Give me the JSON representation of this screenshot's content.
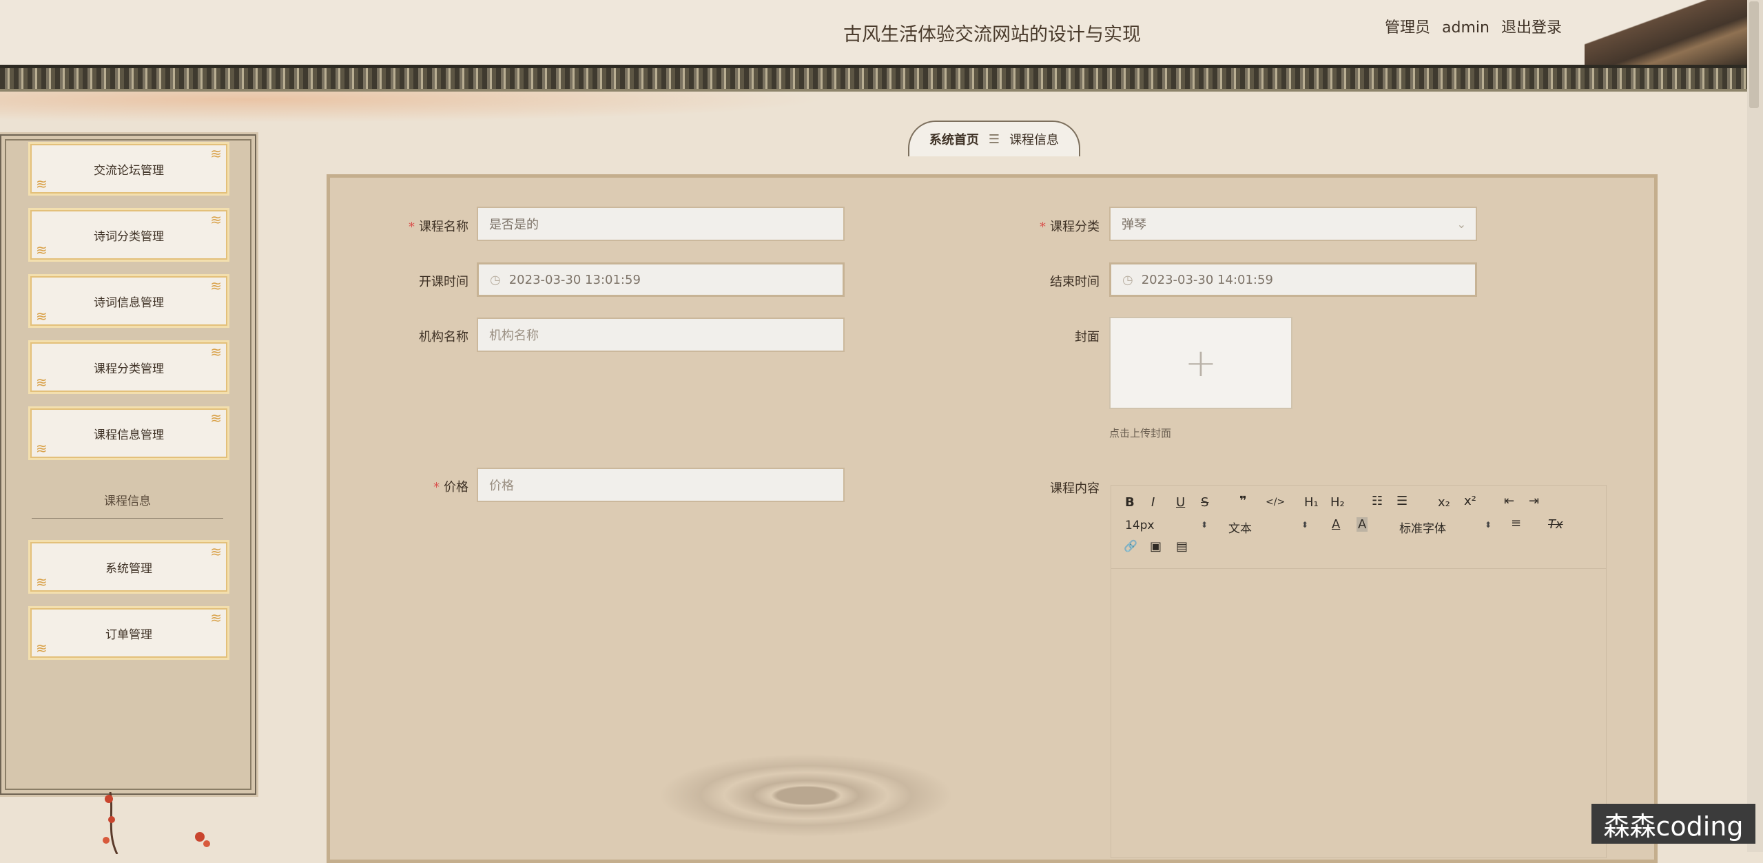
{
  "header": {
    "title": "古风生活体验交流网站的设计与实现",
    "user_role": "管理员",
    "username": "admin",
    "logout": "退出登录"
  },
  "sidebar": {
    "items_top": [
      {
        "label": "交流论坛管理"
      },
      {
        "label": "诗词分类管理"
      },
      {
        "label": "诗词信息管理"
      },
      {
        "label": "课程分类管理"
      },
      {
        "label": "课程信息管理"
      }
    ],
    "section_label": "课程信息",
    "items_bottom": [
      {
        "label": "系统管理"
      },
      {
        "label": "订单管理"
      }
    ]
  },
  "breadcrumb": {
    "home": "系统首页",
    "separator": "☰",
    "current": "课程信息"
  },
  "form": {
    "course_name": {
      "label": "课程名称",
      "required": true,
      "value": "是否是的"
    },
    "course_category": {
      "label": "课程分类",
      "required": true,
      "value": "弹琴"
    },
    "start_time": {
      "label": "开课时间",
      "value": "2023-03-30 13:01:59"
    },
    "end_time": {
      "label": "结束时间",
      "value": "2023-03-30 14:01:59"
    },
    "org_name": {
      "label": "机构名称",
      "placeholder": "机构名称"
    },
    "cover": {
      "label": "封面",
      "upload_hint": "点击上传封面",
      "plus": "+"
    },
    "price": {
      "label": "价格",
      "required": true,
      "placeholder": "价格"
    },
    "content": {
      "label": "课程内容"
    }
  },
  "editor_toolbar": {
    "bold": "B",
    "italic": "I",
    "underline": "U",
    "strike": "S",
    "blockquote": "❞",
    "code": "</>",
    "h1": "H₁",
    "h2": "H₂",
    "ordered_list": "☷",
    "bullet_list": "☰",
    "subscript": "x₂",
    "superscript": "x²",
    "outdent": "⇤",
    "indent": "⇥",
    "font_size": "14px",
    "header_select": "文本",
    "font_color": "A",
    "background_color": "A",
    "font_family": "标准字体",
    "align": "≡",
    "clean": "Tx",
    "link": "🔗",
    "image": "▣",
    "video": "▤"
  },
  "watermark": "森森coding"
}
